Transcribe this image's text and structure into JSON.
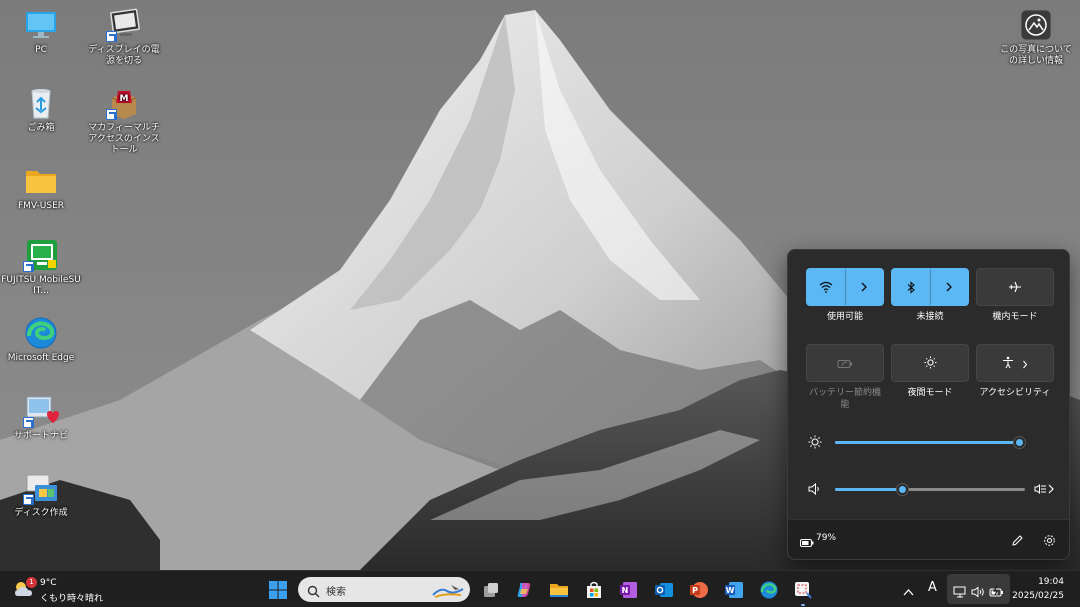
{
  "desktop": {
    "icons": [
      {
        "label": "PC",
        "icon": "monitor-icon"
      },
      {
        "label": "ディスプレイの電源を切る",
        "icon": "display-off-icon"
      },
      {
        "label": "ごみ箱",
        "icon": "recycle-bin-icon"
      },
      {
        "label": "マカフィーマルチアクセスのインストール",
        "icon": "mcafee-icon"
      },
      {
        "label": "FMV-USER",
        "icon": "folder-icon"
      },
      {
        "label": "FUJITSU MobileSUIT...",
        "icon": "fujitsu-mobilesuite-icon"
      },
      {
        "label": "Microsoft Edge",
        "icon": "edge-icon"
      },
      {
        "label": "サポートナビ",
        "icon": "support-navi-icon"
      },
      {
        "label": "ディスク作成",
        "icon": "disk-creator-icon"
      },
      {
        "label": "この写真についての詳しい情報",
        "icon": "photo-info-icon"
      }
    ]
  },
  "quick_settings": {
    "tiles": [
      {
        "label": "使用可能",
        "icon": "wifi-icon",
        "state": "on",
        "expandable": true
      },
      {
        "label": "未接続",
        "icon": "bluetooth-icon",
        "state": "on",
        "expandable": true
      },
      {
        "label": "機内モード",
        "icon": "airplane-icon",
        "state": "off",
        "expandable": false
      },
      {
        "label": "バッテリー節約機能",
        "icon": "battery-saver-icon",
        "state": "disabled",
        "expandable": false
      },
      {
        "label": "夜間モード",
        "icon": "night-light-icon",
        "state": "off",
        "expandable": false
      },
      {
        "label": "アクセシビリティ",
        "icon": "accessibility-icon",
        "state": "off",
        "expandable": true
      }
    ],
    "brightness": {
      "icon": "brightness-icon",
      "level": 0.97
    },
    "volume": {
      "icon": "speaker-icon",
      "level": 0.35,
      "output_icon": "audio-output-icon"
    },
    "battery_text": "79%",
    "battery_icon": "battery-charging-icon",
    "edit_icon": "pencil-icon",
    "settings_icon": "gear-icon"
  },
  "taskbar": {
    "weather": {
      "temp": "9°C",
      "condition": "くもり時々晴れ",
      "badge": "1"
    },
    "search_placeholder": "検索",
    "apps": [
      "start-icon",
      "search-icon",
      "task-view-icon",
      "copilot-icon",
      "file-explorer-icon",
      "store-icon",
      "onenote-icon",
      "outlook-icon",
      "powerpoint-icon",
      "word-icon",
      "edge-icon",
      "snipping-tool-icon"
    ],
    "tray": {
      "ime": "A",
      "time": "19:04",
      "date": "2025/02/25"
    }
  },
  "colors": {
    "accent": "#5cb8f5",
    "panel": "#2b2b2b",
    "taskbar": "#1f1f1f"
  }
}
